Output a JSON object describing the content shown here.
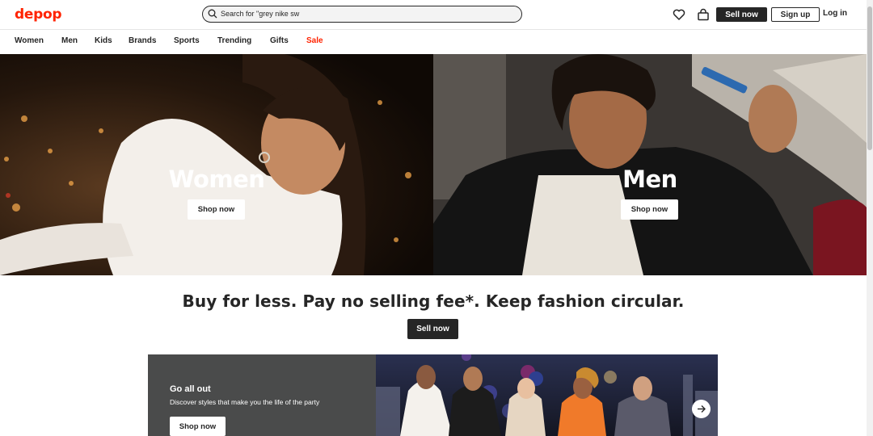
{
  "header": {
    "logo": "depop",
    "search_value": "Search for \"grey nike sw",
    "sell_label": "Sell now",
    "signup_label": "Sign up",
    "login_label": "Log in",
    "icons": [
      "search-icon",
      "heart-icon",
      "bag-icon"
    ]
  },
  "nav": {
    "items": [
      "Women",
      "Men",
      "Kids",
      "Brands",
      "Sports",
      "Trending",
      "Gifts",
      "Sale"
    ]
  },
  "hero": {
    "women": {
      "title": "Women",
      "button": "Shop now"
    },
    "men": {
      "title": "Men",
      "button": "Shop now"
    }
  },
  "tagline": {
    "text": "Buy for less. Pay no selling fee*. Keep fashion circular.",
    "button": "Sell now"
  },
  "promo": {
    "title": "Go all out",
    "subtitle": "Discover styles that make you the life of the party",
    "button": "Shop now"
  },
  "colors": {
    "brand": "#ff2300",
    "dark": "#262626",
    "promo_bg": "#4a4b4b"
  }
}
